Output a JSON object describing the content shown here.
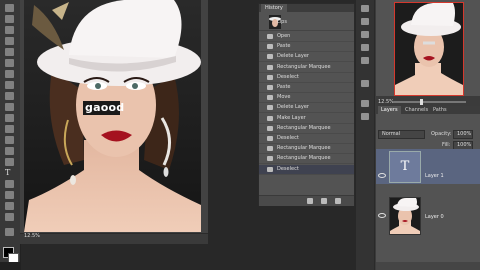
{
  "canvas": {
    "overlay_text": "gaood",
    "zoom": "12.5%"
  },
  "history": {
    "tab": "History",
    "snapshot": "Lips",
    "items": [
      "Open",
      "Paste",
      "Delete Layer",
      "Rectangular Marquee",
      "Deselect",
      "Paste",
      "Move",
      "Delete Layer",
      "Make Layer",
      "Rectangular Marquee",
      "Deselect",
      "Rectangular Marquee",
      "Rectangular Marquee",
      "Deselect"
    ],
    "selected_index": 13
  },
  "navigator": {
    "zoom": "12.5%"
  },
  "layers": {
    "tabs": [
      "Layers",
      "Channels",
      "Paths"
    ],
    "blend_mode": "Normal",
    "opacity_label": "Opacity:",
    "opacity_value": "100%",
    "fill_label": "Fill:",
    "fill_value": "100%",
    "text_thumb_glyph": "T",
    "items": [
      {
        "name": "Layer 1",
        "selected": true
      },
      {
        "name": "Layer 0",
        "selected": false
      }
    ]
  },
  "colors": {
    "accent_selection": "#5a6580",
    "nav_frame": "#d4382d"
  }
}
